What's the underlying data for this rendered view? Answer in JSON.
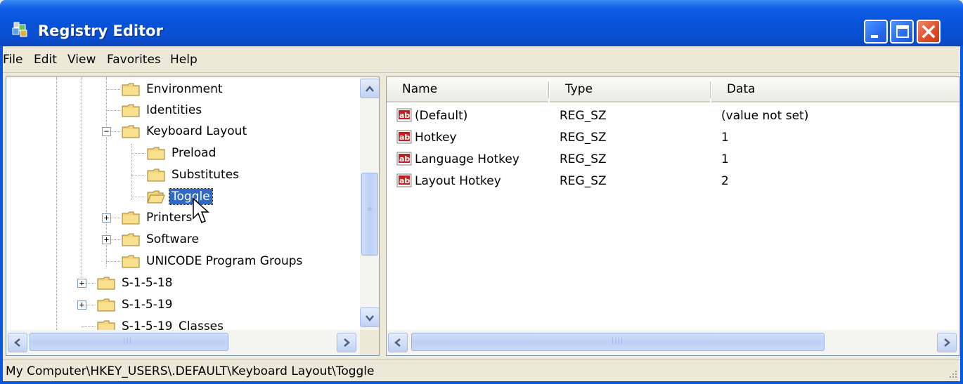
{
  "window": {
    "title": "Registry Editor"
  },
  "menu": [
    "File",
    "Edit",
    "View",
    "Favorites",
    "Help"
  ],
  "tree": {
    "items": [
      {
        "label": "Environment"
      },
      {
        "label": "Identities"
      },
      {
        "label": "Keyboard Layout",
        "expander": "−"
      },
      {
        "label": "Preload"
      },
      {
        "label": "Substitutes"
      },
      {
        "label": "Toggle",
        "selected": true
      },
      {
        "label": "Printers",
        "expander": "+"
      },
      {
        "label": "Software",
        "expander": "+"
      },
      {
        "label": "UNICODE Program Groups"
      },
      {
        "label": "S-1-5-18",
        "expander": "+"
      },
      {
        "label": "S-1-5-19",
        "expander": "+"
      },
      {
        "label": "S-1-5-19_Classes"
      }
    ]
  },
  "list": {
    "columns": [
      "Name",
      "Type",
      "Data"
    ],
    "rows": [
      {
        "name": "(Default)",
        "type": "REG_SZ",
        "data": "(value not set)"
      },
      {
        "name": "Hotkey",
        "type": "REG_SZ",
        "data": "1"
      },
      {
        "name": "Language Hotkey",
        "type": "REG_SZ",
        "data": "1"
      },
      {
        "name": "Layout Hotkey",
        "type": "REG_SZ",
        "data": "2"
      }
    ]
  },
  "status": {
    "path": "My Computer\\HKEY_USERS\\.DEFAULT\\Keyboard Layout\\Toggle"
  },
  "icons": {
    "app": "registry-editor-icon",
    "folder": "folder-icon",
    "value": "string-value-icon",
    "minimize": "minimize-icon",
    "maximize": "maximize-icon",
    "close": "close-icon"
  },
  "colors": {
    "title_bar": "#0a4fd2",
    "selection": "#316ac5",
    "face": "#ece9d8",
    "close_button": "#e0502c"
  }
}
